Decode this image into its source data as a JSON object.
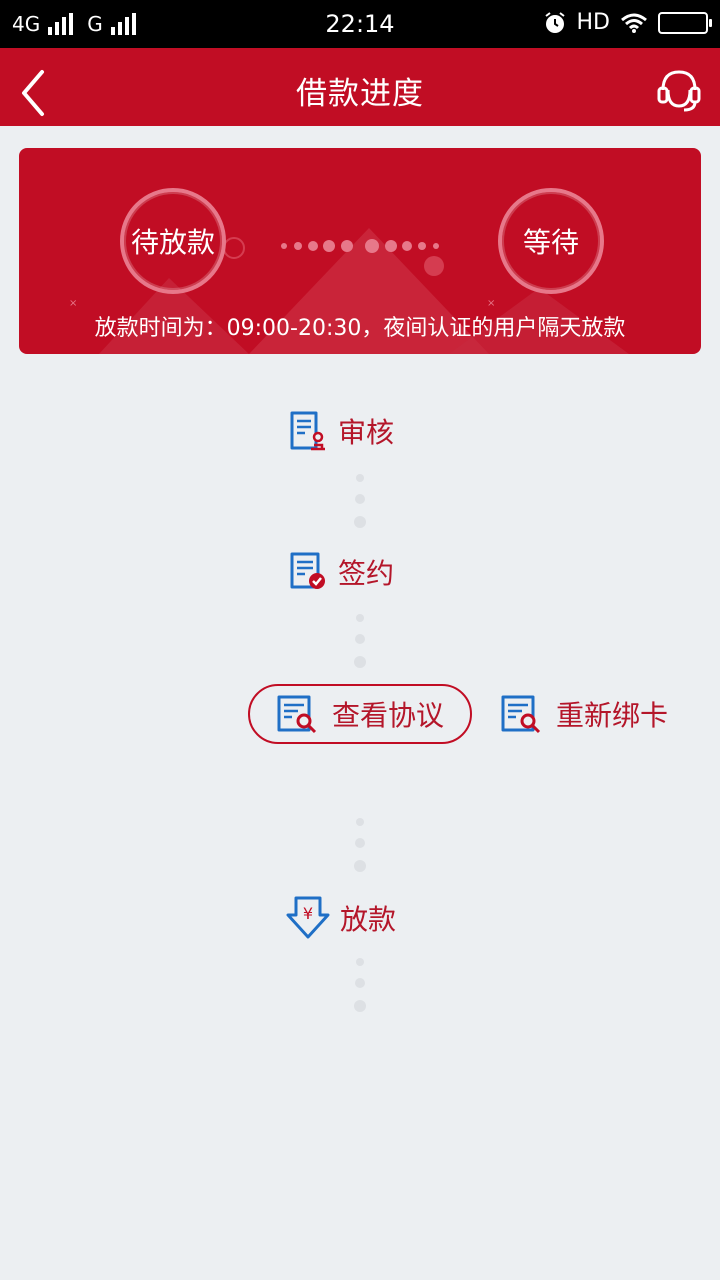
{
  "status_bar": {
    "network_1": "4G",
    "network_2": "G",
    "time": "22:14",
    "hd": "HD",
    "icons": [
      "signal-bars-icon",
      "alarm-clock-icon",
      "wifi-icon",
      "battery-icon"
    ]
  },
  "nav": {
    "title": "借款进度",
    "back_icon": "chevron-left-icon",
    "service_icon": "headset-icon"
  },
  "banner": {
    "state_left": "待放款",
    "state_right": "等待",
    "note": "放款时间为：09:00-20:30，夜间认证的用户隔天放款"
  },
  "steps": [
    {
      "label": "审核",
      "icon": "document-stamp-icon"
    },
    {
      "label": "签约",
      "icon": "document-check-icon"
    },
    {
      "label": "放款",
      "icon": "yuan-download-icon"
    }
  ],
  "actions": {
    "view_agreement": "查看协议",
    "rebind_card": "重新绑卡"
  },
  "colors": {
    "brand": "#c10d24",
    "accent_text": "#b4162a",
    "icon_blue": "#1f6fc6",
    "background": "#eceff2"
  }
}
